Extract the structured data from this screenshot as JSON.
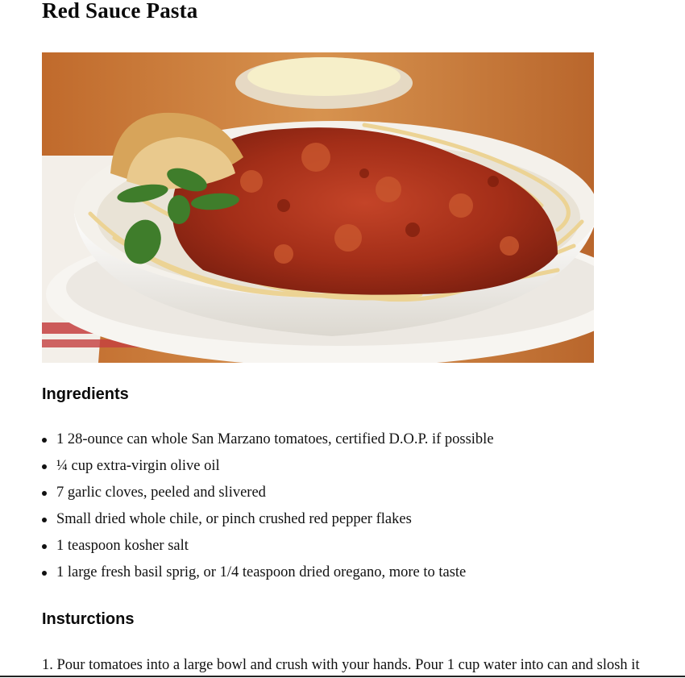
{
  "recipe": {
    "title": "Red Sauce Pasta",
    "image_alt": "Plate of spaghetti with red tomato sauce, basil and garlic bread"
  },
  "ingredients": {
    "heading": "Ingredients",
    "items": [
      "1 28-ounce can whole San Marzano tomatoes, certified D.O.P. if possible",
      "¼ cup extra-virgin olive oil",
      "7 garlic cloves, peeled and slivered",
      " Small dried whole chile, or pinch crushed red pepper flakes",
      "1 teaspoon kosher salt",
      "1 large fresh basil sprig, or 1/4 teaspoon dried oregano, more to taste"
    ]
  },
  "instructions": {
    "heading": "Insturctions",
    "steps": [
      "1. Pour tomatoes into a large bowl and crush with your hands. Pour 1 cup water into can and slosh it"
    ]
  },
  "colors": {
    "sauce": "#a8321c",
    "pasta": "#efd9a0",
    "bowl": "#f4f2ee",
    "table": "#c9803e"
  }
}
